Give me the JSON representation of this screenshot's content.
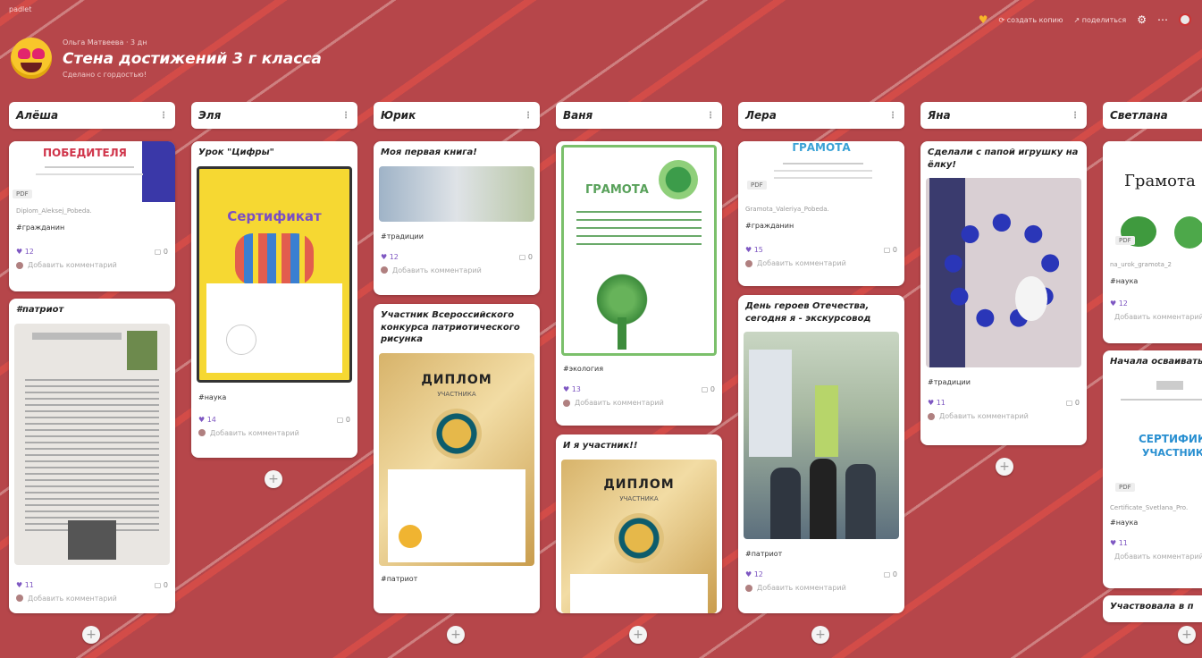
{
  "brand": "padlet",
  "header": {
    "author": "Ольга Матвеева · 3 дн",
    "title": "Стена достижений 3 г класса",
    "subtitle": "Сделано с гордостью!",
    "actions": {
      "remake": "создать копию",
      "share": "поделиться"
    }
  },
  "columns": [
    {
      "name": "Алёша"
    },
    {
      "name": "Эля"
    },
    {
      "name": "Юрик"
    },
    {
      "name": "Ваня"
    },
    {
      "name": "Лера"
    },
    {
      "name": "Яна"
    },
    {
      "name": "Светлана"
    }
  ],
  "cards": {
    "alesha1": {
      "doc_text": "ПОБЕДИТЕЛЯ",
      "pdf": "PDF",
      "file": "Diplom_Aleksej_Pobeda.",
      "tag": "#гражданин",
      "likes": "12",
      "comments": "0",
      "add_comment": "Добавить комментарий"
    },
    "alesha2": {
      "title": "#патриот",
      "likes": "11",
      "comments": "0",
      "add_comment": "Добавить комментарий"
    },
    "elya1": {
      "title": "Урок \"Цифры\"",
      "cert": "Сертификат",
      "tag": "#наука",
      "likes": "14",
      "comments": "0",
      "add_comment": "Добавить комментарий"
    },
    "yurik1": {
      "title": "Моя первая книга!",
      "tag": "#традиции",
      "likes": "12",
      "comments": "0",
      "add_comment": "Добавить комментарий"
    },
    "yurik2": {
      "title": "Участник Всероссийского конкурса патриотического рисунка",
      "diplom": "ДИПЛОМ",
      "sub": "УЧАСТНИКА",
      "tag": "#патриот"
    },
    "vanya1": {
      "gramota": "ГРАМОТА",
      "tag": "#экология",
      "likes": "13",
      "comments": "0",
      "add_comment": "Добавить комментарий"
    },
    "vanya2": {
      "title": "И я участник!!",
      "diplom": "ДИПЛОМ",
      "sub": "УЧАСТНИКА"
    },
    "lera1": {
      "gramota": "ГРАМОТА",
      "pdf": "PDF",
      "file": "Gramota_Valeriya_Pobeda.",
      "tag": "#гражданин",
      "likes": "15",
      "comments": "0",
      "add_comment": "Добавить комментарий"
    },
    "lera2": {
      "title": "День героев Отечества, сегодня я - экскурсовод",
      "tag": "#патриот",
      "likes": "12",
      "comments": "0",
      "add_comment": "Добавить комментарий"
    },
    "yana1": {
      "title": "Сделали с папой игрушку на ёлку!",
      "tag": "#традиции",
      "likes": "11",
      "comments": "0",
      "add_comment": "Добавить комментарий"
    },
    "svetlana1": {
      "gramota": "Грамота",
      "pdf": "PDF",
      "file": "na_urok_gramota_2",
      "tag": "#наука",
      "likes": "12",
      "add_comment": "Добавить комментарий"
    },
    "svetlana2": {
      "title": "Начала осваивать программирование",
      "cert": "СЕРТИФИКАТ",
      "sub": "УЧАСТНИКА",
      "pdf": "PDF",
      "file": "Certificate_Svetlana_Pro.",
      "tag": "#наука",
      "likes": "11",
      "add_comment": "Добавить комментарий"
    },
    "svetlana3": {
      "title": "Участвовала в п"
    }
  },
  "icons": [
    "heart-icon",
    "star-icon",
    "share-icon",
    "gear-icon",
    "more-icon",
    "avatar",
    "plus-icon",
    "comment-icon"
  ]
}
